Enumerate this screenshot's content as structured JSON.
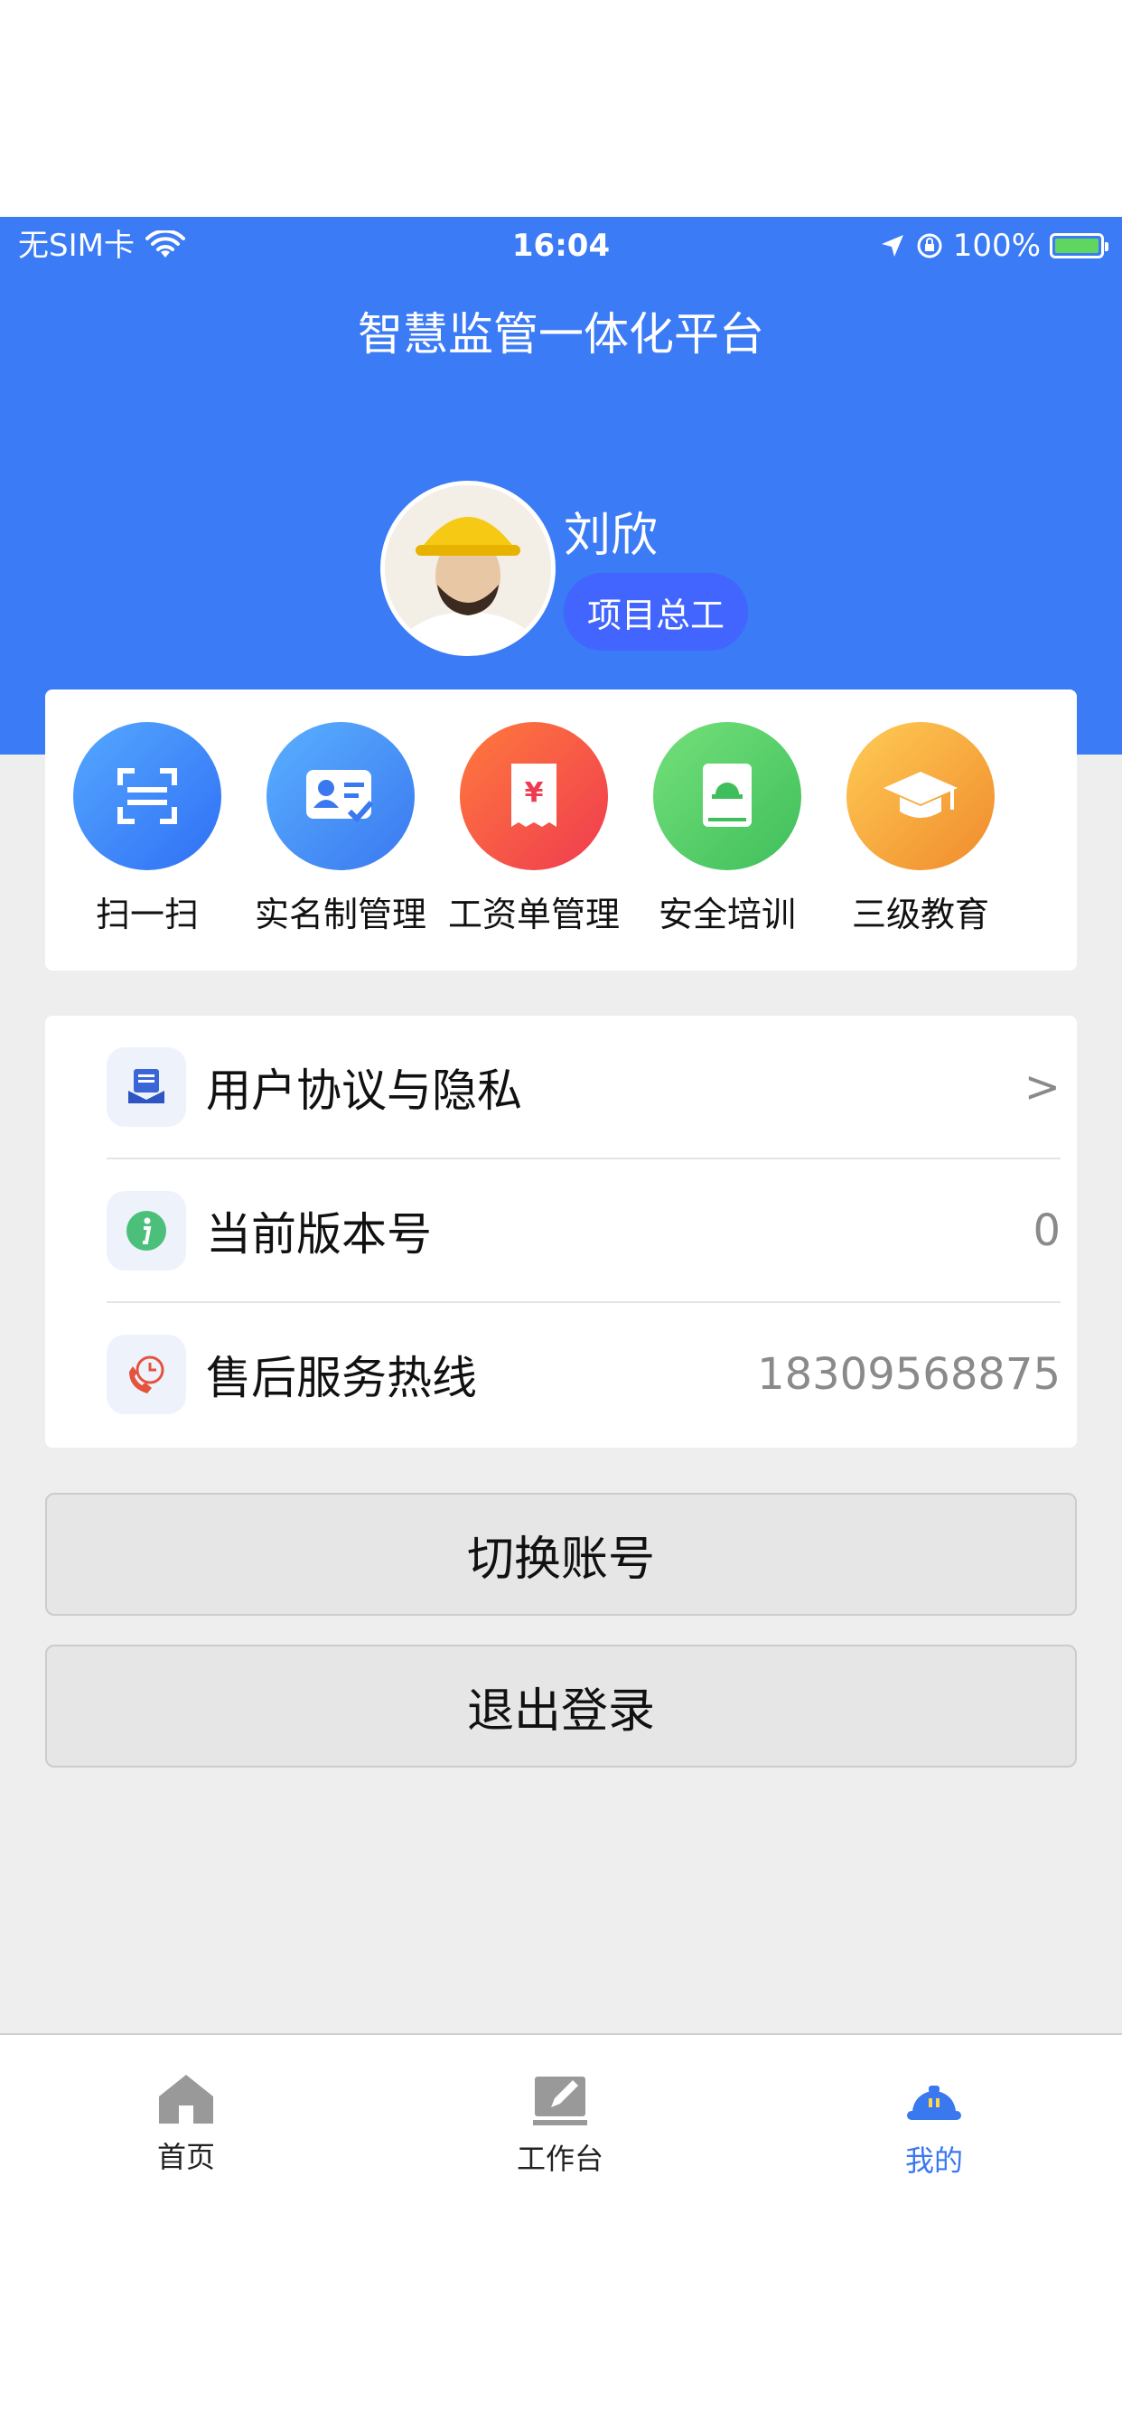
{
  "status_bar": {
    "carrier": "无SIM卡",
    "time": "16:04",
    "battery": "100%"
  },
  "header": {
    "title": "智慧监管一体化平台"
  },
  "profile": {
    "name": "刘欣",
    "role": "项目总工"
  },
  "quick_actions": [
    {
      "label": "扫一扫",
      "icon": "scan-icon",
      "color_from": "#55a8ff",
      "color_to": "#2f6ff5"
    },
    {
      "label": "实名制管理",
      "icon": "id-card-icon",
      "color_from": "#5ab0ff",
      "color_to": "#3a78f0"
    },
    {
      "label": "工资单管理",
      "icon": "payslip-icon",
      "color_from": "#ff7a3d",
      "color_to": "#ef3b4f"
    },
    {
      "label": "安全培训",
      "icon": "safety-book-icon",
      "color_from": "#74e07a",
      "color_to": "#3fbf5b"
    },
    {
      "label": "三级教育",
      "icon": "graduation-cap-icon",
      "color_from": "#ffcc55",
      "color_to": "#f08a2c"
    }
  ],
  "menu": [
    {
      "label": "用户协议与隐私",
      "value": ">",
      "icon": "document-icon"
    },
    {
      "label": "当前版本号",
      "value": "0",
      "icon": "info-icon"
    },
    {
      "label": "售后服务热线",
      "value": "18309568875",
      "icon": "phone-icon"
    }
  ],
  "buttons": {
    "switch_account": "切换账号",
    "logout": "退出登录"
  },
  "tabbar": [
    {
      "label": "首页",
      "icon": "home-icon"
    },
    {
      "label": "工作台",
      "icon": "workbench-icon"
    },
    {
      "label": "我的",
      "icon": "helmet-icon",
      "active": true
    }
  ],
  "colors": {
    "primary": "#3b7bf5",
    "active_tab": "#3a78f0",
    "role_badge": "#4264ff"
  }
}
